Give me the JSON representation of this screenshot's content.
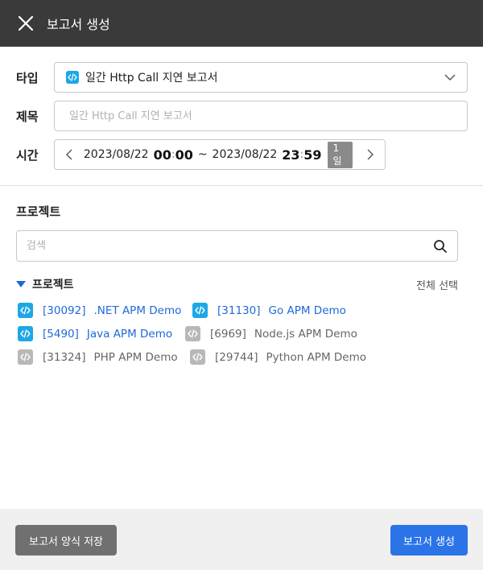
{
  "header": {
    "title": "보고서 생성",
    "close_icon": "close-icon"
  },
  "form": {
    "type_label": "타입",
    "type_value": "일간 Http Call 지연 보고서",
    "title_label": "제목",
    "title_placeholder": "일간 Http Call 지연 보고서",
    "time_label": "시간",
    "time": {
      "start_date": "2023/08/22",
      "start_hour": "00",
      "start_min": "00",
      "range_sep": "~",
      "end_date": "2023/08/22",
      "end_hour": "23",
      "end_min": "59",
      "duration_badge": "1일"
    }
  },
  "projects_section": {
    "title": "프로젝트",
    "search_placeholder": "검색",
    "group_title": "프로젝트",
    "select_all": "전체 선택",
    "items": [
      {
        "id": "[30092]",
        "name": ".NET APM Demo",
        "active": true
      },
      {
        "id": "[31130]",
        "name": "Go APM Demo",
        "active": true
      },
      {
        "id": "[5490]",
        "name": "Java APM Demo",
        "active": true
      },
      {
        "id": "[6969]",
        "name": "Node.js APM Demo",
        "active": false
      },
      {
        "id": "[31324]",
        "name": "PHP APM Demo",
        "active": false
      },
      {
        "id": "[29744]",
        "name": "Python APM Demo",
        "active": false
      }
    ]
  },
  "footer": {
    "save_template_label": "보고서 양식 저장",
    "create_label": "보고서 생성"
  },
  "colors": {
    "header_bg": "#3a3a3a",
    "accent": "#2b74e8",
    "project_active": "#1e6ad8",
    "project_icon_active": "#1ea7e5",
    "project_icon_inactive": "#b8b8b8"
  }
}
